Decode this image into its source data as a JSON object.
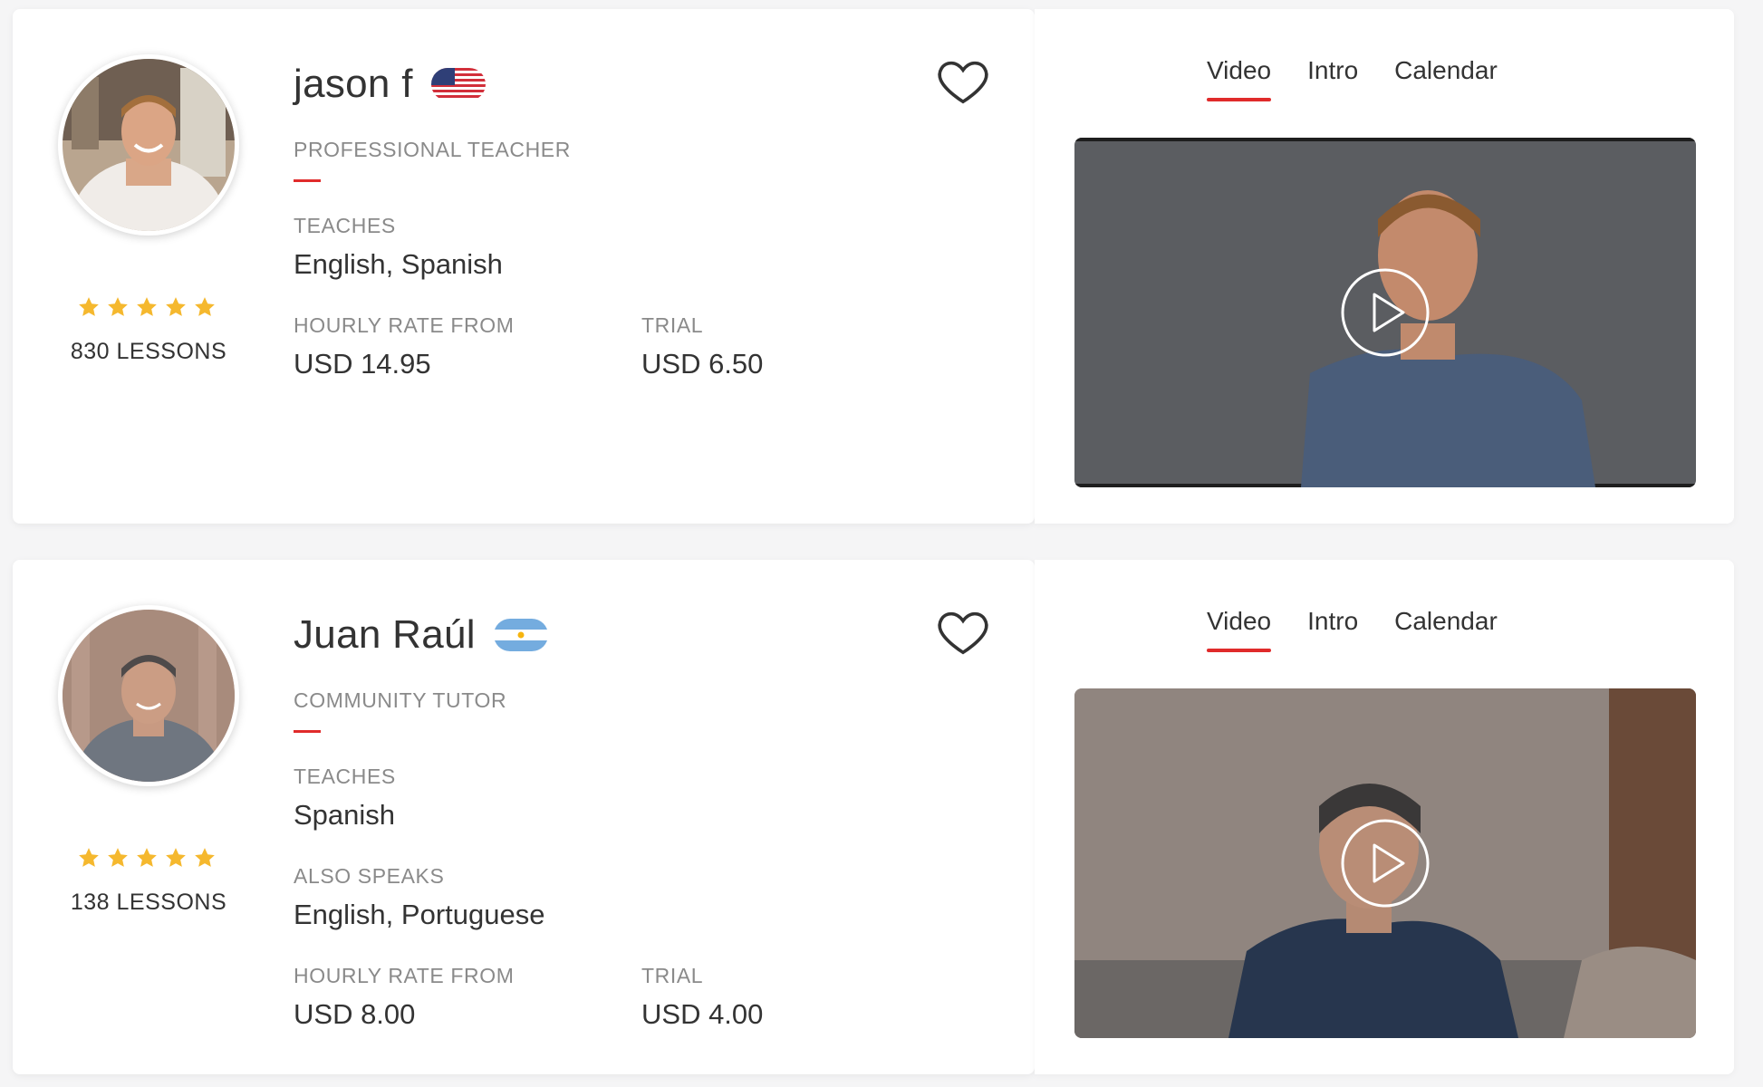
{
  "tutors": [
    {
      "name": "jason f",
      "flag": "us-flag-icon",
      "role": "PROFESSIONAL TEACHER",
      "teaches_label": "TEACHES",
      "teaches": "English, Spanish",
      "hourly_label": "HOURLY RATE FROM",
      "hourly": "USD 14.95",
      "trial_label": "TRIAL",
      "trial": "USD 6.50",
      "rating_stars": 5,
      "lessons": "830 LESSONS",
      "tabs": [
        "Video",
        "Intro",
        "Calendar"
      ],
      "active_tab": "Video"
    },
    {
      "name": "Juan Raúl",
      "flag": "argentina-flag-icon",
      "role": "COMMUNITY TUTOR",
      "teaches_label": "TEACHES",
      "teaches": "Spanish",
      "also_speaks_label": "ALSO SPEAKS",
      "also_speaks": "English, Portuguese",
      "hourly_label": "HOURLY RATE FROM",
      "hourly": "USD 8.00",
      "trial_label": "TRIAL",
      "trial": "USD 4.00",
      "rating_stars": 5,
      "lessons": "138 LESSONS",
      "tabs": [
        "Video",
        "Intro",
        "Calendar"
      ],
      "active_tab": "Video"
    }
  ],
  "colors": {
    "accent": "#e02b2b",
    "star": "#f5b82e",
    "muted_text": "#8a8a8a",
    "primary_text": "#333333"
  },
  "icons": {
    "favorite": "heart-outline-icon",
    "play": "play-circle-icon",
    "star": "star-icon"
  }
}
